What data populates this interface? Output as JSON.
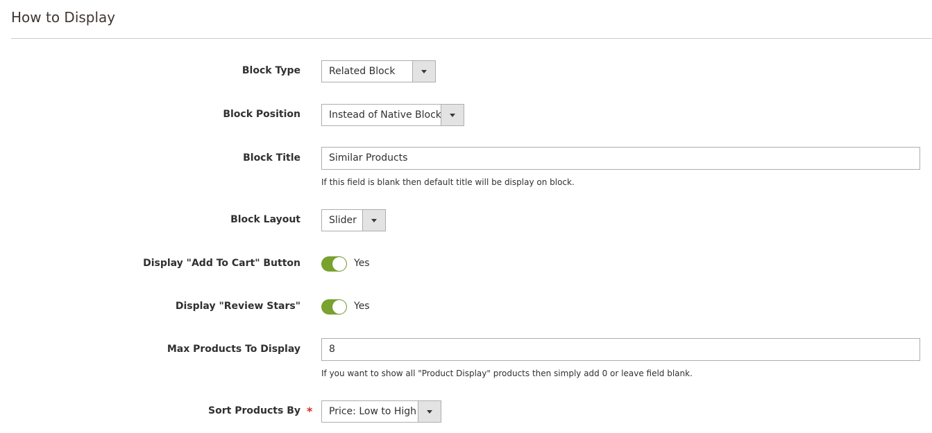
{
  "section": {
    "title": "How to Display"
  },
  "fields": {
    "block_type": {
      "label": "Block Type",
      "value": "Related Block"
    },
    "block_position": {
      "label": "Block Position",
      "value": "Instead of Native Block"
    },
    "block_title": {
      "label": "Block Title",
      "value": "Similar Products",
      "note": "If this field is blank then default title will be display on block."
    },
    "block_layout": {
      "label": "Block Layout",
      "value": "Slider"
    },
    "add_to_cart": {
      "label": "Display \"Add To Cart\" Button",
      "state": "Yes"
    },
    "review_stars": {
      "label": "Display \"Review Stars\"",
      "state": "Yes"
    },
    "max_products": {
      "label": "Max Products To Display",
      "value": "8",
      "note": "If you want to show all \"Product Display\" products then simply add 0 or leave field blank."
    },
    "sort_by": {
      "label": "Sort Products By",
      "required": "*",
      "value": "Price: Low to High"
    }
  },
  "colors": {
    "toggle_on": "#79a22e",
    "required": "#e22626"
  }
}
